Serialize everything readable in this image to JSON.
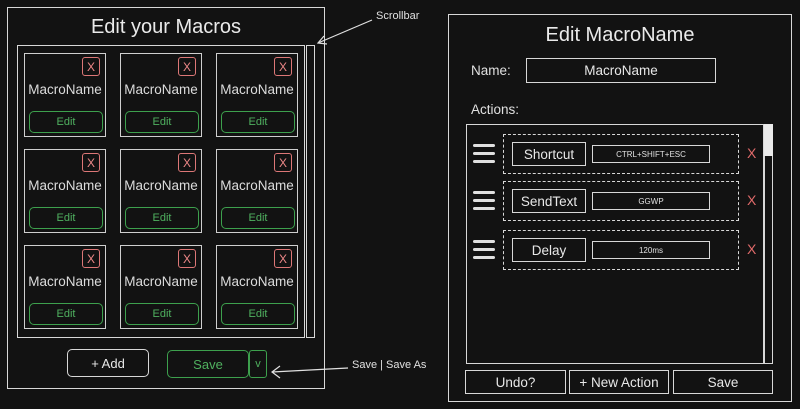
{
  "left_panel": {
    "title": "Edit your Macros",
    "cards": [
      {
        "name": "MacroName",
        "close": "X",
        "edit": "Edit"
      },
      {
        "name": "MacroName",
        "close": "X",
        "edit": "Edit"
      },
      {
        "name": "MacroName",
        "close": "X",
        "edit": "Edit"
      },
      {
        "name": "MacroName",
        "close": "X",
        "edit": "Edit"
      },
      {
        "name": "MacroName",
        "close": "X",
        "edit": "Edit"
      },
      {
        "name": "MacroName",
        "close": "X",
        "edit": "Edit"
      },
      {
        "name": "MacroName",
        "close": "X",
        "edit": "Edit"
      },
      {
        "name": "MacroName",
        "close": "X",
        "edit": "Edit"
      },
      {
        "name": "MacroName",
        "close": "X",
        "edit": "Edit"
      }
    ],
    "add_label": "+ Add",
    "save_label": "Save",
    "save_dropdown": "v"
  },
  "annotations": {
    "scrollbar": "Scrollbar",
    "save_options": "Save | Save As"
  },
  "right_panel": {
    "title": "Edit MacroName",
    "name_label": "Name:",
    "name_value": "MacroName",
    "actions_label": "Actions:",
    "actions": [
      {
        "type": "Shortcut",
        "value": "CTRL+SHIFT+ESC",
        "remove": "X"
      },
      {
        "type": "SendText",
        "value": "GGWP",
        "remove": "X"
      },
      {
        "type": "Delay",
        "value": "120ms",
        "remove": "X"
      }
    ],
    "undo_label": "Undo?",
    "new_action_label": "+ New Action",
    "save_label": "Save"
  },
  "colors": {
    "accent_green": "#4fb05f",
    "close_red": "#e06a6a",
    "background": "#121212"
  }
}
